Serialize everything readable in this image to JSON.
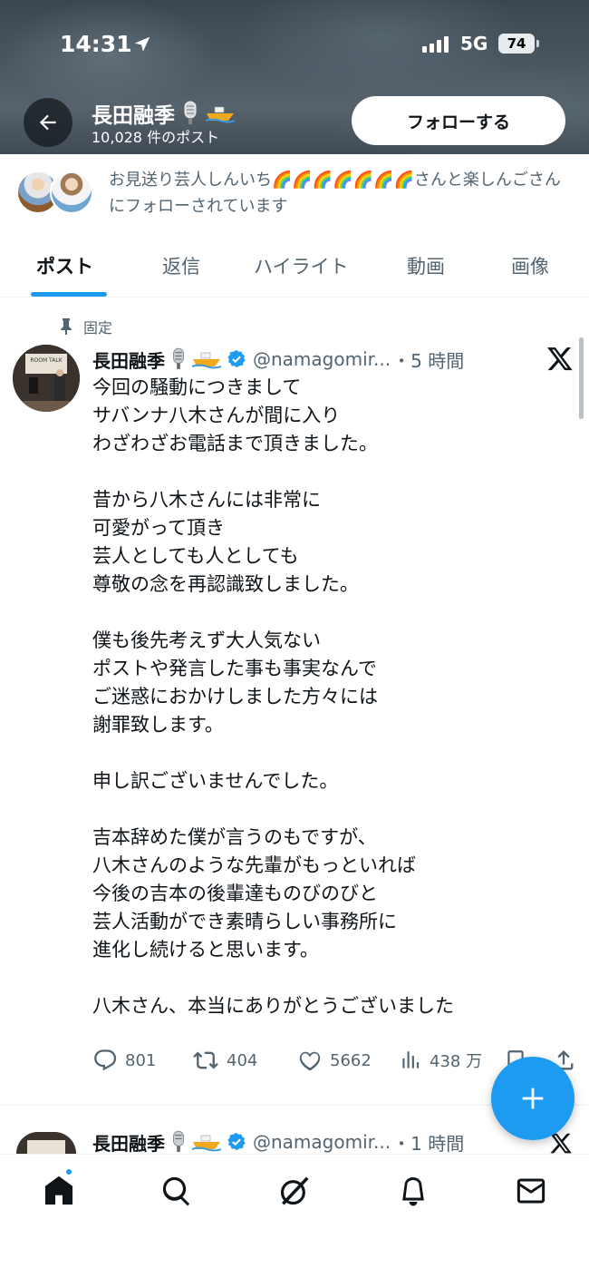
{
  "status_bar": {
    "time": "14:31",
    "network": "5G",
    "battery": "74"
  },
  "header": {
    "name": "長田融季",
    "posts_count": "10,028 件のポスト",
    "follow_label": "フォローする"
  },
  "followed_by": {
    "text": "お見送り芸人しんいち🌈🌈🌈🌈🌈🌈🌈さんと楽しんごさんにフォローされています"
  },
  "tabs": [
    {
      "label": "ポスト"
    },
    {
      "label": "返信"
    },
    {
      "label": "ハイライト"
    },
    {
      "label": "動画"
    },
    {
      "label": "画像"
    }
  ],
  "pinned_post": {
    "pinned_label": "固定",
    "author": "長田融季",
    "handle": "@namagomir...",
    "time": "・5 時間",
    "lines": [
      "今回の騒動につきまして",
      "サバンナ八木さんが間に入り",
      "わざわざお電話まで頂きました。",
      "",
      "昔から八木さんには非常に",
      "可愛がって頂き",
      "芸人としても人としても",
      "尊敬の念を再認識致しました。",
      "",
      "僕も後先考えず大人気ない",
      "ポストや発言した事も事実なんで",
      "ご迷惑におかけしました方々には",
      "謝罪致します。",
      "",
      "申し訳ございませんでした。",
      "",
      "吉本辞めた僕が言うのもですが、",
      "八木さんのような先輩がもっといれば",
      "今後の吉本の後輩達ものびのびと",
      "芸人活動ができ素晴らしい事務所に",
      "進化し続けると思います。",
      "",
      "八木さん、本当にありがとうございました"
    ],
    "stats": {
      "replies": "801",
      "reposts": "404",
      "likes": "5662",
      "views": "438 万"
    }
  },
  "second_post": {
    "author": "長田融季",
    "handle": "@namagomir...",
    "time": "・1 時間"
  },
  "colors": {
    "accent": "#1d9bf0",
    "text": "#0f1419",
    "secondary": "#536471"
  },
  "icons": [
    "back-arrow-icon",
    "microphone-emoji",
    "boat-emoji",
    "verified-badge-icon",
    "x-logo-icon",
    "pin-icon",
    "reply-icon",
    "repost-icon",
    "like-icon",
    "views-icon",
    "bookmark-icon",
    "share-icon",
    "compose-plus-icon",
    "home-icon",
    "search-icon",
    "grok-icon",
    "notifications-icon",
    "messages-icon"
  ]
}
